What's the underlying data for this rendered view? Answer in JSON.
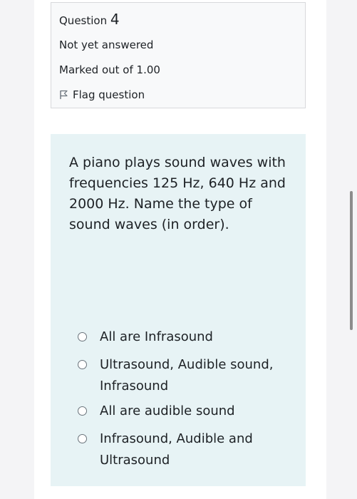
{
  "question_info": {
    "label": "Question",
    "number": "4",
    "state": "Not yet answered",
    "grade": "Marked out of 1.00",
    "flag_label": "Flag question"
  },
  "question": {
    "text": "A piano plays sound waves with frequencies 125 Hz, 640 Hz and 2000 Hz. Name the type of sound waves (in order).",
    "options": [
      {
        "label": "All are Infrasound",
        "selected": false
      },
      {
        "label": "Ultrasound, Audible sound, Infrasound",
        "selected": false
      },
      {
        "label": "All are audible sound",
        "selected": false
      },
      {
        "label": "Infrasound, Audible and Ultrasound",
        "selected": false
      }
    ]
  },
  "colors": {
    "info_bg": "#f8f9fa",
    "content_bg": "#e7f3f5",
    "text": "#1d2125"
  }
}
